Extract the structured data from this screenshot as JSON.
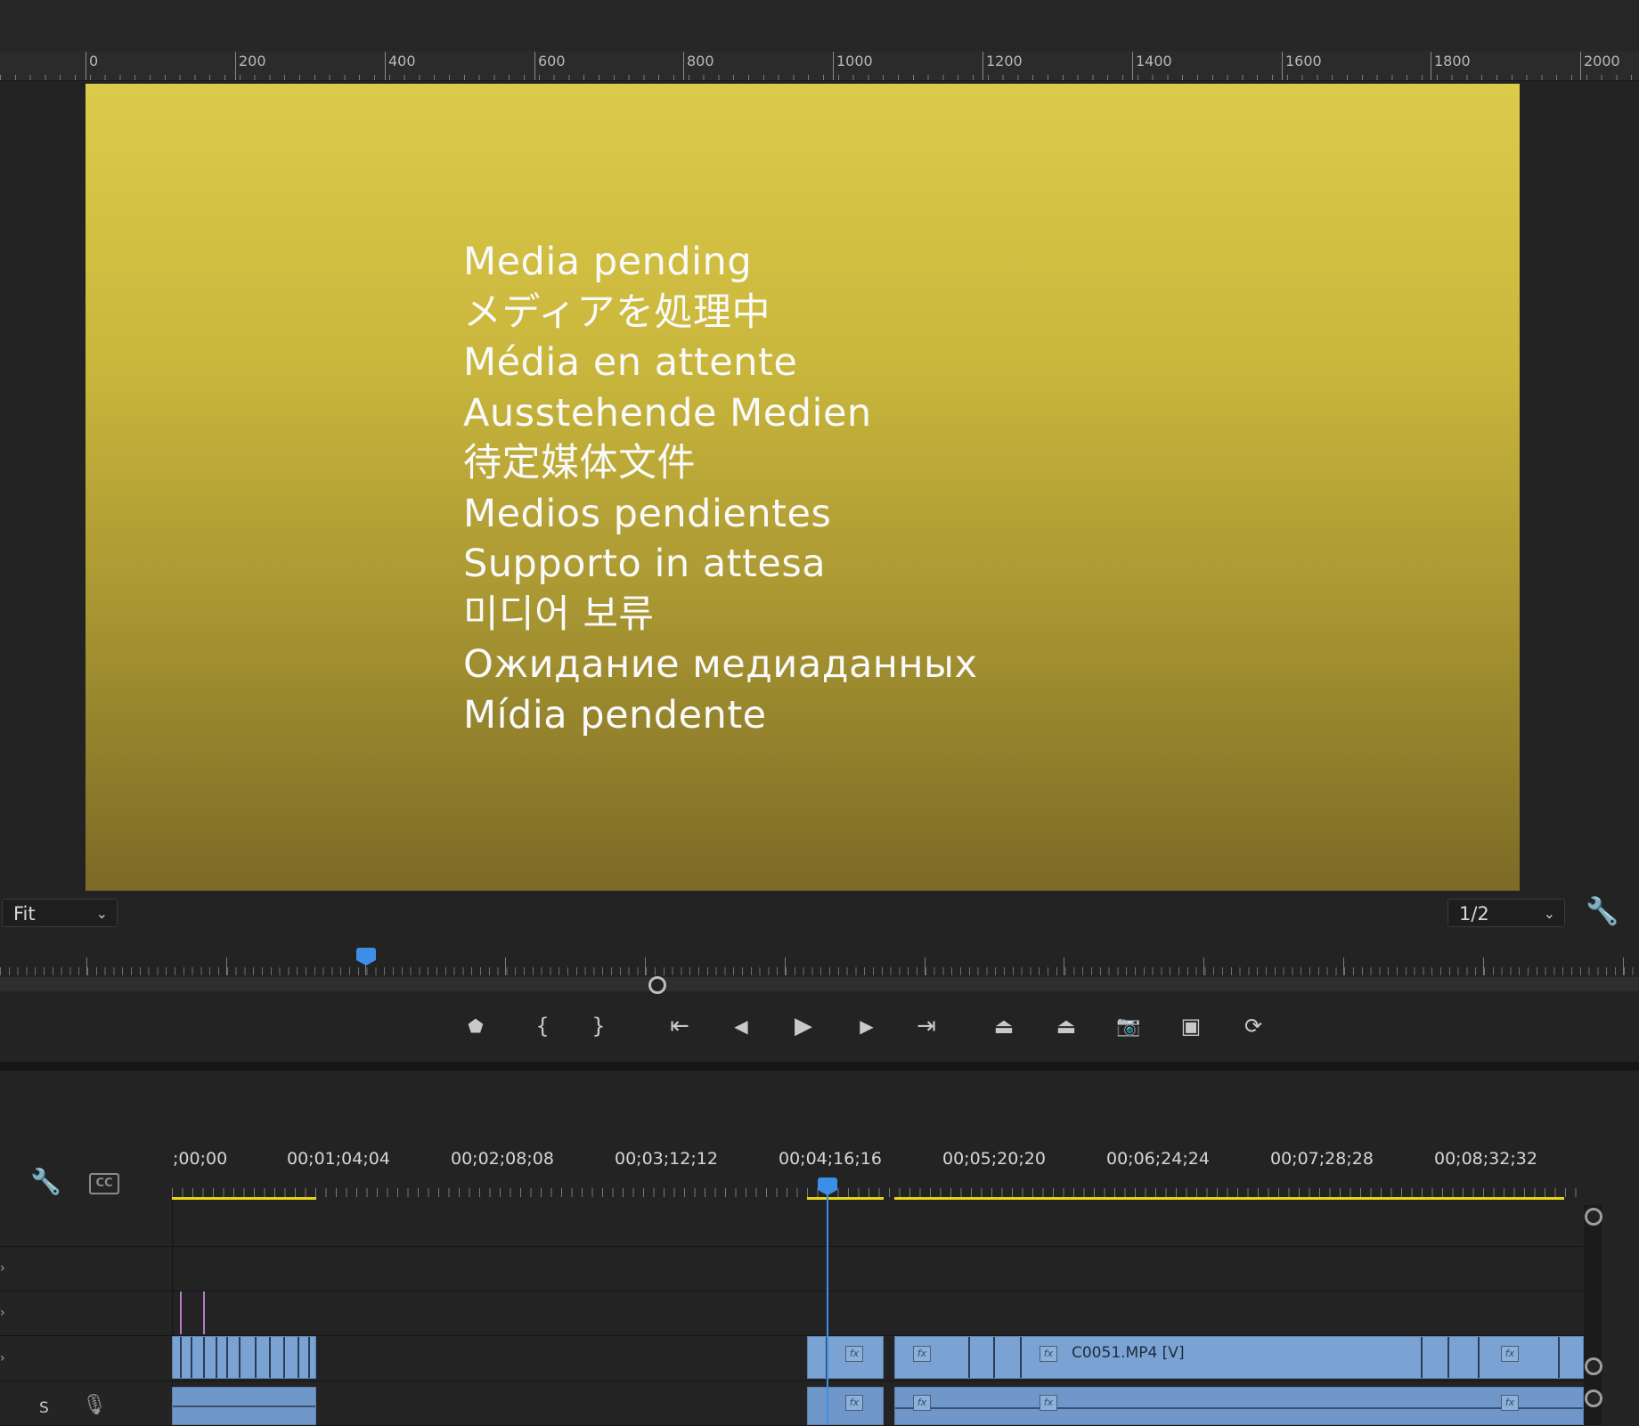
{
  "ruler": {
    "labels": [
      "0",
      "200",
      "400",
      "600",
      "800",
      "1000",
      "1200",
      "1400",
      "1600",
      "1800",
      "2000"
    ]
  },
  "preview": {
    "lines": [
      "Media pending",
      "メディアを処理中",
      "Média en attente",
      "Ausstehende Medien",
      "待定媒体文件",
      "Medios pendientes",
      "Supporto in attesa",
      "미디어 보류",
      "Ожидание медиаданных",
      "Mídia pendente"
    ]
  },
  "monitor": {
    "zoom_value": "Fit",
    "resolution_value": "1/2"
  },
  "transport": {
    "buttons": [
      {
        "name": "add-marker-button",
        "glyph": "⬟"
      },
      {
        "name": "mark-in-button",
        "glyph": "{"
      },
      {
        "name": "mark-out-button",
        "glyph": "}"
      },
      {
        "name": "go-to-in-button",
        "glyph": "⇤"
      },
      {
        "name": "step-back-button",
        "glyph": "◀"
      },
      {
        "name": "play-button",
        "glyph": "▶"
      },
      {
        "name": "step-forward-button",
        "glyph": "▶"
      },
      {
        "name": "go-to-out-button",
        "glyph": "⇥"
      },
      {
        "name": "lift-button",
        "glyph": "⏏"
      },
      {
        "name": "extract-button",
        "glyph": "⏏"
      },
      {
        "name": "export-frame-button",
        "glyph": "📷"
      },
      {
        "name": "comparison-view-button",
        "glyph": "▣"
      },
      {
        "name": "toggle-proxies-button",
        "glyph": "⟳"
      }
    ]
  },
  "timeline": {
    "timecodes": [
      ";00;00",
      "00;01;04;04",
      "00;02;08;08",
      "00;03;12;12",
      "00;04;16;16",
      "00;05;20;20",
      "00;06;24;24",
      "00;07;28;28",
      "00;08;32;32"
    ],
    "fx_label": "fx",
    "clip_name": "C0051.MP4 [V]",
    "audio_track_solo": "S"
  },
  "colors": {
    "accent_blue": "#3d8ee6",
    "clip_blue": "#7aa3d4",
    "work_area_yellow": "#e6d61a"
  }
}
